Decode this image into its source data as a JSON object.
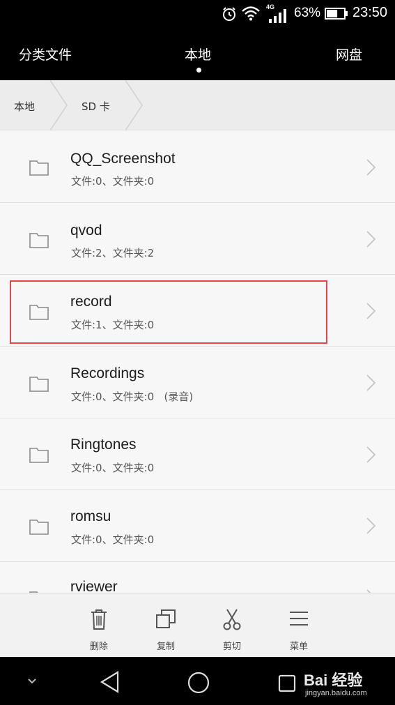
{
  "status_bar": {
    "network_label": "4G",
    "battery_percent": "63%",
    "battery_level": 0.63,
    "time": "23:50",
    "icons": [
      "alarm-icon",
      "wifi-icon",
      "signal-icon",
      "battery-icon"
    ]
  },
  "tabs": [
    {
      "label": "分类文件",
      "active": false
    },
    {
      "label": "本地",
      "active": true
    },
    {
      "label": "网盘",
      "active": false
    }
  ],
  "breadcrumb": [
    "本地",
    "SD 卡"
  ],
  "files": [
    {
      "name": "QQ_Screenshot",
      "meta": "文件:0、文件夹:0"
    },
    {
      "name": "qvod",
      "meta": "文件:2、文件夹:2"
    },
    {
      "name": "record",
      "meta": "文件:1、文件夹:0",
      "highlighted": true
    },
    {
      "name": "Recordings",
      "meta": "文件:0、文件夹:0   (录音)"
    },
    {
      "name": "Ringtones",
      "meta": "文件:0、文件夹:0"
    },
    {
      "name": "romsu",
      "meta": "文件:0、文件夹:0"
    },
    {
      "name": "rviewer",
      "meta": ""
    }
  ],
  "actions": [
    {
      "label": "删除",
      "icon": "trash-icon"
    },
    {
      "label": "复制",
      "icon": "copy-icon"
    },
    {
      "label": "剪切",
      "icon": "scissors-icon"
    },
    {
      "label": "菜单",
      "icon": "menu-icon"
    }
  ],
  "nav": {
    "icons": [
      "chevron-down-icon",
      "back-icon",
      "home-icon",
      "recent-apps-icon"
    ]
  },
  "watermark": {
    "brand": "Bai 经验",
    "url": "jingyan.baidu.com"
  },
  "colors": {
    "bar_background": "#000000",
    "list_background": "#f7f7f7",
    "highlight": "#e84646"
  }
}
